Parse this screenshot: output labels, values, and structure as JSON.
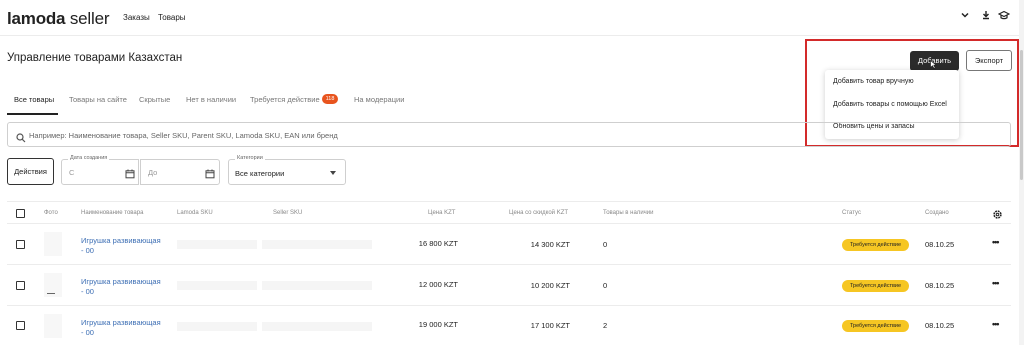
{
  "header": {
    "logo_brand": "lamoda",
    "logo_sub": "seller",
    "nav": [
      "Заказы",
      "Товары"
    ]
  },
  "page": {
    "title": "Управление товарами Казахстан",
    "add_label": "Добавить",
    "export_label": "Экспорт"
  },
  "add_menu": {
    "items": [
      "Добавить товар вручную",
      "Добавить товары с помощью Excel",
      "Обновить цены и запасы"
    ]
  },
  "tabs": {
    "items": [
      "Все товары",
      "Товары на сайте",
      "Скрытые",
      "Нет в наличии",
      "Требуется действие",
      "На модерации"
    ],
    "action_count": "118"
  },
  "search": {
    "placeholder": "Например: Наименование товара, Seller SKU, Parent SKU, Lamoda SKU, EAN или бренд"
  },
  "filters": {
    "actions_label": "Действия",
    "date_label": "Дата создания",
    "date_from": "С",
    "date_to": "До",
    "category_label": "Категории",
    "category_value": "Все категории"
  },
  "table": {
    "headers": [
      "Фото",
      "Наименование товара",
      "Lamoda SKU",
      "Seller SKU",
      "Цена KZT",
      "Цена со скидкой KZT",
      "Товары в наличии",
      "Статус",
      "Создано"
    ],
    "rows": [
      {
        "name": "Игрушка развивающая - 00",
        "price": "16 800 KZT",
        "discount": "14 300 KZT",
        "stock": "0",
        "status": "Требуется действие",
        "created": "08.10.25"
      },
      {
        "name": "Игрушка развивающая - 00",
        "price": "12 000 KZT",
        "discount": "10 200 KZT",
        "stock": "0",
        "status": "Требуется действие",
        "created": "08.10.25"
      },
      {
        "name": "Игрушка развивающая - 00",
        "price": "19 000 KZT",
        "discount": "17 100 KZT",
        "stock": "2",
        "status": "Требуется действие",
        "created": "08.10.25"
      }
    ]
  },
  "colors": {
    "accent_dark": "#2b2b2b",
    "badge": "#e8541e",
    "status": "#f6c623",
    "link": "#3c6eb4",
    "highlight": "#d32a2a"
  }
}
